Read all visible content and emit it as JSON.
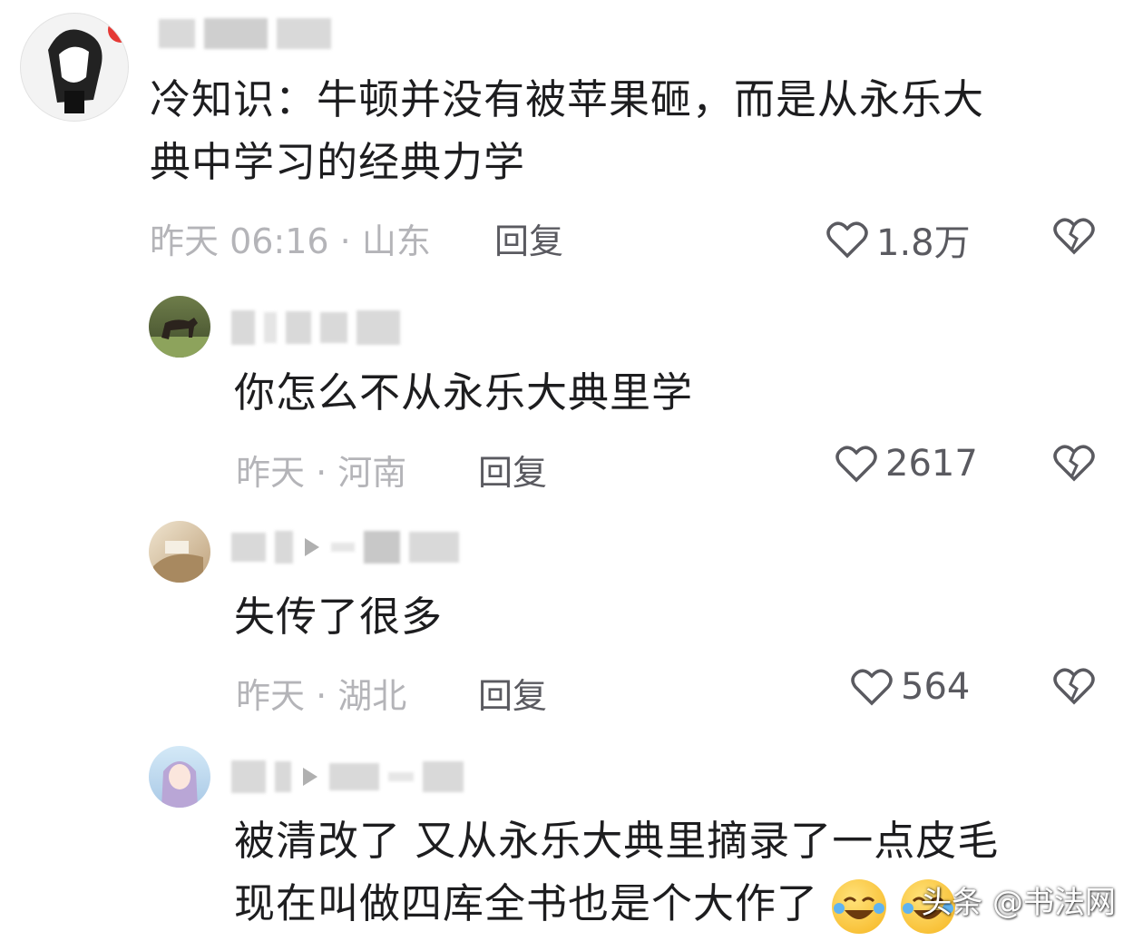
{
  "comments": [
    {
      "text_lines": [
        "冷知识：牛顿并没有被苹果砸，而是从永乐大",
        "典中学习的经典力学"
      ],
      "meta": "昨天 06:16 · 山东",
      "reply_label": "回复",
      "likes": "1.8万"
    },
    {
      "text_lines": [
        "你怎么不从永乐大典里学"
      ],
      "meta": "昨天 · 河南",
      "reply_label": "回复",
      "likes": "2617"
    },
    {
      "text_lines": [
        "失传了很多"
      ],
      "meta": "昨天 · 湖北",
      "reply_label": "回复",
      "likes": "564"
    },
    {
      "text_lines": [
        "被清改了 又从永乐大典里摘录了一点皮毛",
        "现在叫做四库全书也是个大作了"
      ],
      "meta": "",
      "reply_label": "",
      "likes": ""
    }
  ],
  "watermark": "头条 @书法网",
  "icons": {
    "like": "heart-outline-icon",
    "dislike": "broken-heart-icon",
    "emoji": "laughing-crying-emoji-icon"
  },
  "colors": {
    "text": "#1d1d1f",
    "meta": "#b4b4b8",
    "icon": "#5a5a60"
  }
}
